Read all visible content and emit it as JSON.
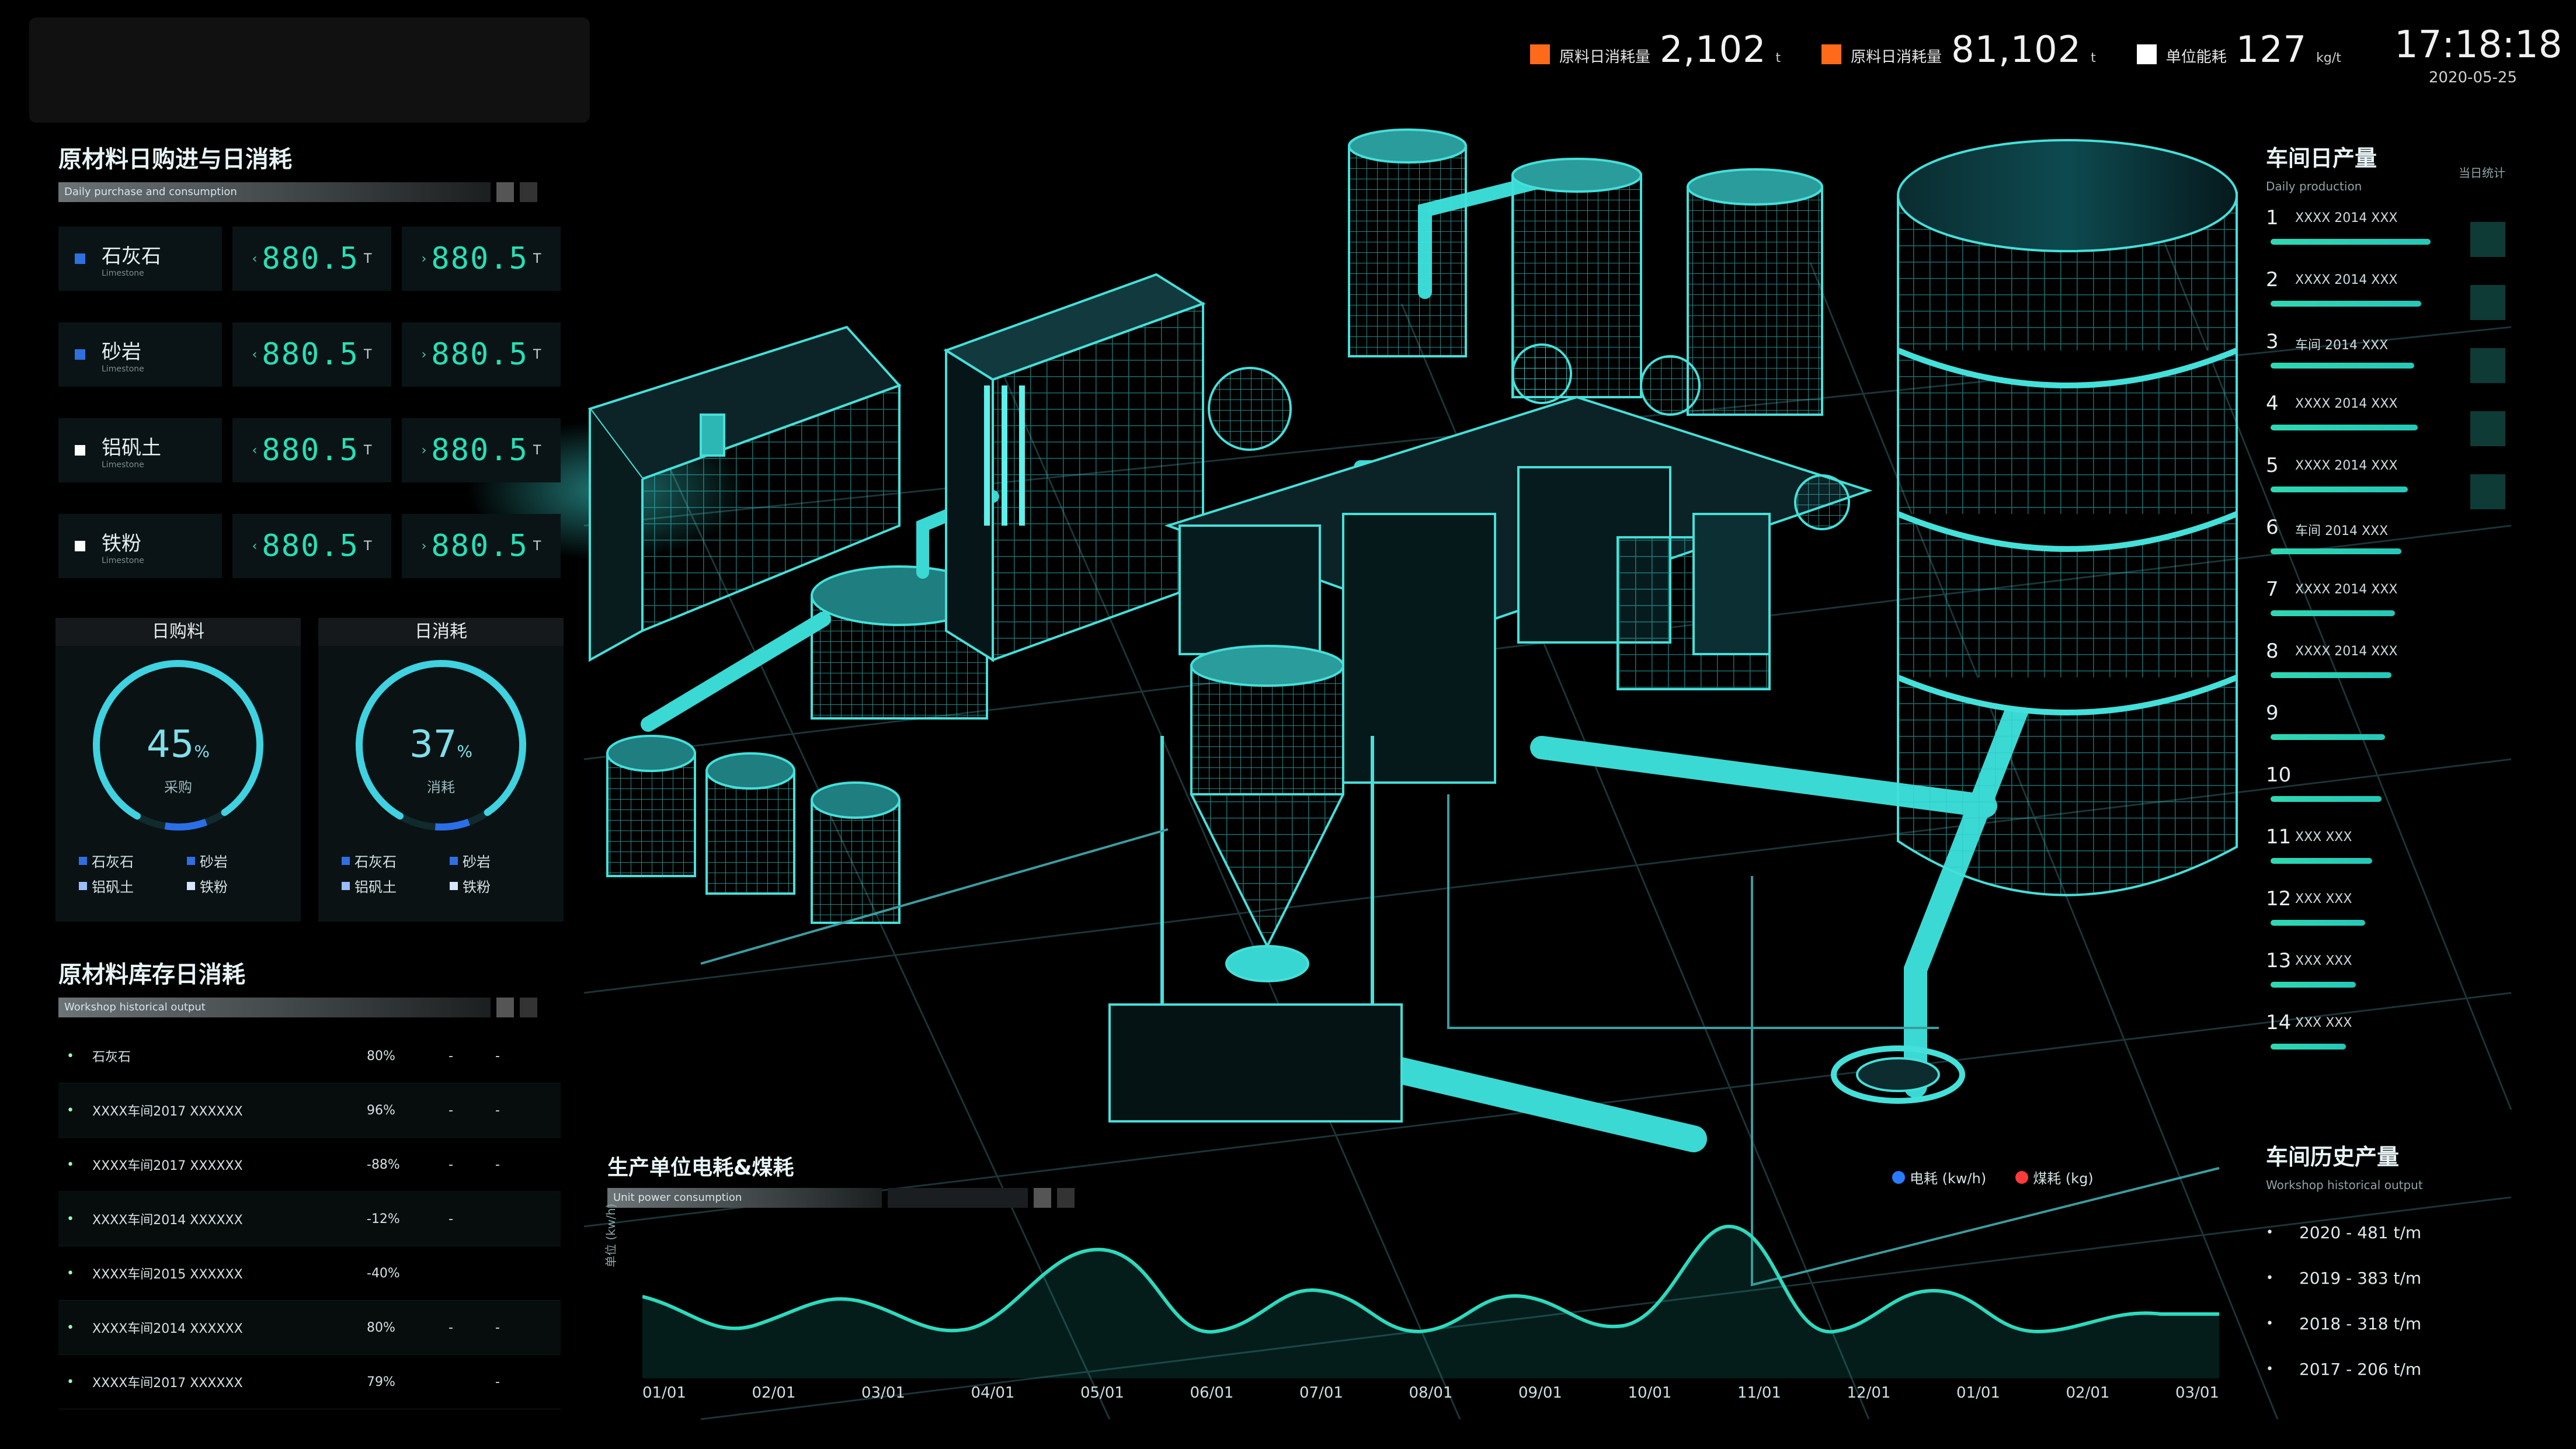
{
  "header": {
    "time": "17:18:18",
    "date": "2020-05-25",
    "stats": [
      {
        "label": "原料日消耗量",
        "value": "2,102",
        "unit": "t",
        "color": "#ff6a1a"
      },
      {
        "label": "原料日消耗量",
        "value": "81,102",
        "unit": "t",
        "color": "#ff6a1a"
      },
      {
        "label": "单位能耗",
        "value": "127",
        "unit": "kg/t",
        "color": "#ffffff"
      }
    ]
  },
  "left": {
    "purchase_title": "原材料日购进与日消耗",
    "purchase_sub": "Daily purchase and consumption",
    "materials": [
      {
        "name": "石灰石",
        "en": "Limestone",
        "color": "#2f6fe0",
        "in": "880.5",
        "out": "880.5",
        "unit": "T"
      },
      {
        "name": "砂岩",
        "en": "Limestone",
        "color": "#2f6fe0",
        "in": "880.5",
        "out": "880.5",
        "unit": "T"
      },
      {
        "name": "铝矾土",
        "en": "Limestone",
        "color": "#ffffff",
        "in": "880.5",
        "out": "880.5",
        "unit": "T"
      },
      {
        "name": "铁粉",
        "en": "Limestone",
        "color": "#ffffff",
        "in": "880.5",
        "out": "880.5",
        "unit": "T"
      }
    ],
    "gauges": [
      {
        "title": "日购料",
        "percent": 45,
        "label": "采购",
        "legend": [
          "石灰石",
          "砂岩",
          "铝矾土",
          "铁粉"
        ]
      },
      {
        "title": "日消耗",
        "percent": 37,
        "label": "消耗",
        "legend": [
          "石灰石",
          "砂岩",
          "铝矾土",
          "铁粉"
        ]
      }
    ],
    "workshop_title": "原材料库存日消耗",
    "workshop_sub": "Workshop historical output",
    "workshop_rows": [
      {
        "name": "石灰石",
        "value": "80%",
        "a": "-",
        "b": "-"
      },
      {
        "name": "XXXX车间2017 XXXXXX",
        "value": "96%",
        "a": "-",
        "b": "-"
      },
      {
        "name": "XXXX车间2017 XXXXXX",
        "value": "-88%",
        "a": "-",
        "b": "-"
      },
      {
        "name": "XXXX车间2014 XXXXXX",
        "value": "-12%",
        "a": "-",
        "b": ""
      },
      {
        "name": "XXXX车间2015 XXXXXX",
        "value": "-40%",
        "a": "",
        "b": ""
      },
      {
        "name": "XXXX车间2014 XXXXXX",
        "value": "80%",
        "a": "-",
        "b": "-"
      },
      {
        "name": "XXXX车间2017 XXXXXX",
        "value": "79%",
        "a": "",
        "b": "-"
      }
    ]
  },
  "bottom_chart": {
    "title": "生产单位电耗&煤耗",
    "sub": "Unit power consumption",
    "legend": [
      {
        "name": "电耗 (kw/h)",
        "color": "#2a7cff"
      },
      {
        "name": "煤耗 (kg)",
        "color": "#ff3a3a"
      }
    ],
    "ylabel": "单位 (kw/h)",
    "x_ticks": [
      "01/01",
      "02/01",
      "03/01",
      "04/01",
      "05/01",
      "06/01",
      "07/01",
      "08/01",
      "09/01",
      "10/01",
      "11/01",
      "12/01",
      "01/01",
      "02/01",
      "03/01"
    ]
  },
  "right": {
    "rank_title": "车间日产量",
    "rank_sub": "Daily production",
    "rank_extra": "当日统计",
    "rank_items": [
      {
        "n": "1",
        "t": "XXXX 2014 XXX",
        "v": 0.98
      },
      {
        "n": "2",
        "t": "XXXX 2014 XXX",
        "v": 0.92
      },
      {
        "n": "3",
        "t": "车间 2014 XXX",
        "v": 0.88
      },
      {
        "n": "4",
        "t": "XXXX 2014 XXX",
        "v": 0.9
      },
      {
        "n": "5",
        "t": "XXXX 2014 XXX",
        "v": 0.84
      },
      {
        "n": "6",
        "t": "车间 2014 XXX",
        "v": 0.8
      },
      {
        "n": "7",
        "t": "XXXX 2014 XXX",
        "v": 0.76
      },
      {
        "n": "8",
        "t": "XXXX 2014 XXX",
        "v": 0.74
      },
      {
        "n": "9",
        "t": "",
        "v": 0.7
      },
      {
        "n": "10",
        "t": "",
        "v": 0.68
      },
      {
        "n": "11",
        "t": "XXX  XXX",
        "v": 0.62
      },
      {
        "n": "12",
        "t": "XXX  XXX",
        "v": 0.58
      },
      {
        "n": "13",
        "t": "XXX  XXX",
        "v": 0.52
      },
      {
        "n": "14",
        "t": "XXX  XXX",
        "v": 0.46
      }
    ],
    "hist_title": "车间历史产量",
    "hist_sub": "Workshop historical output",
    "hist_items": [
      "2020 - 481 t/m",
      "2019 - 383 t/m",
      "2018 - 318 t/m",
      "2017 - 206 t/m"
    ]
  }
}
